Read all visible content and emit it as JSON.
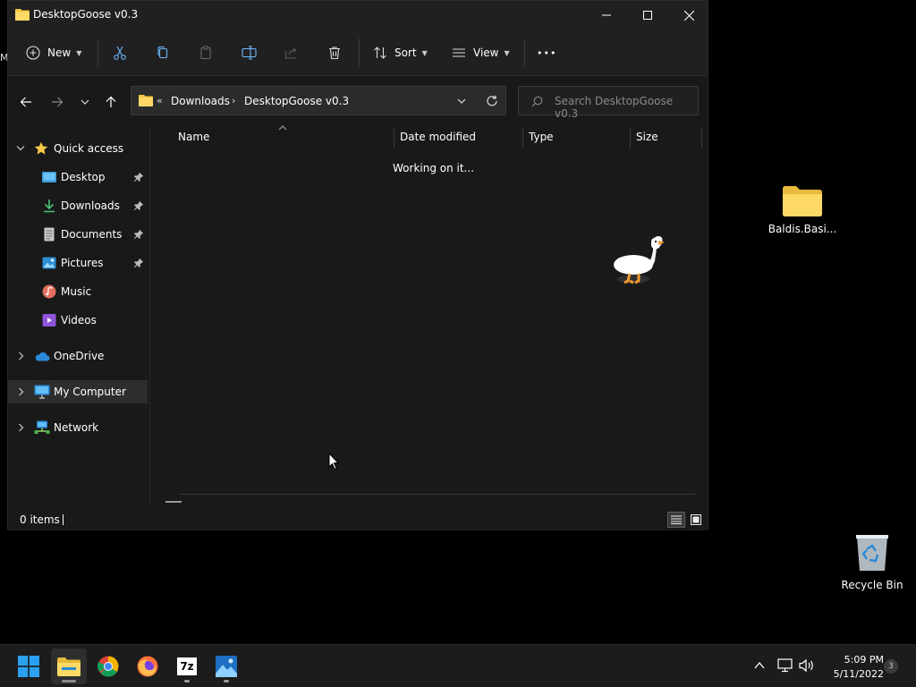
{
  "window": {
    "title": "DesktopGoose v0.3"
  },
  "toolbar": {
    "new_label": "New",
    "sort_label": "Sort",
    "view_label": "View",
    "more_label": "•••"
  },
  "address": {
    "overflow": "«",
    "crumbs": [
      "Downloads",
      "DesktopGoose v0.3"
    ],
    "sep": "›"
  },
  "search": {
    "placeholder": "Search DesktopGoose v0.3"
  },
  "nav": {
    "quick_access": "Quick access",
    "items": [
      "Desktop",
      "Downloads",
      "Documents",
      "Pictures",
      "Music",
      "Videos"
    ],
    "onedrive": "OneDrive",
    "my_computer": "My Computer",
    "network": "Network"
  },
  "columns": {
    "name": "Name",
    "date_modified": "Date modified",
    "type": "Type",
    "size": "Size"
  },
  "content": {
    "status_message": "Working on it..."
  },
  "status": {
    "items": "0 items"
  },
  "desktop": {
    "folder_label": "Baldis.Basi...",
    "recycle_label": "Recycle Bin",
    "edge_letter": "M"
  },
  "taskbar": {
    "time": "5:09 PM",
    "date": "5/11/2022",
    "notifications": "3",
    "sevenzip_label": "7z"
  },
  "colors": {
    "folder": "#f4c542",
    "accent": "#4cc2ff",
    "star": "#f7c948"
  }
}
